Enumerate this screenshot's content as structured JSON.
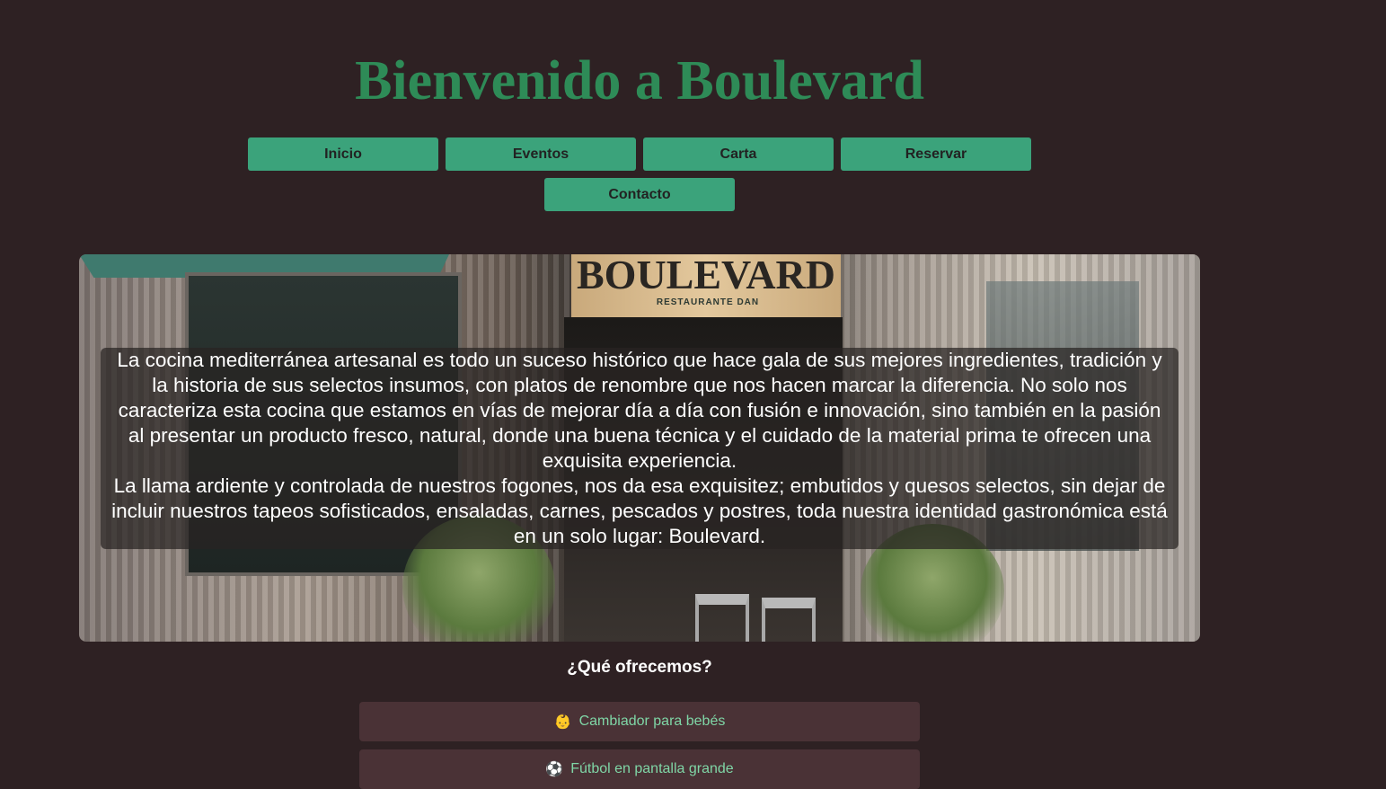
{
  "header": {
    "title": "Bienvenido a Boulevard"
  },
  "nav": {
    "items": [
      {
        "label": "Inicio"
      },
      {
        "label": "Eventos"
      },
      {
        "label": "Carta"
      },
      {
        "label": "Reservar"
      },
      {
        "label": "Contacto"
      }
    ]
  },
  "hero": {
    "sign_text": "BOULEVARD",
    "sign_subtext": "RESTAURANTE DAN",
    "paragraph_1": "La cocina mediterránea artesanal es todo un suceso histórico que hace gala de sus mejores ingredientes, tradición y la historia de sus selectos insumos, con platos de renombre que nos hacen marcar la diferencia. No solo nos caracteriza esta cocina que estamos en vías de mejorar día a día con fusión e innovación, sino también en la pasión al presentar un producto fresco, natural, donde una buena técnica y el cuidado de la material prima te ofrecen una exquisita experiencia.",
    "paragraph_2": "La llama ardiente y controlada de nuestros fogones, nos da esa exquisitez; embutidos y quesos selectos, sin dejar de incluir nuestros tapeos sofisticados, ensaladas, carnes, pescados y postres, toda nuestra identidad gastronómica está en un solo lugar: Boulevard."
  },
  "offers": {
    "heading": "¿Qué ofrecemos?",
    "items": [
      {
        "icon": "baby-icon",
        "glyph": "👶",
        "label": "Cambiador para bebés"
      },
      {
        "icon": "soccer-ball-icon",
        "glyph": "⚽",
        "label": "Fútbol en pantalla grande"
      }
    ]
  },
  "colors": {
    "background": "#2e2123",
    "title_green": "#2e8b57",
    "nav_button": "#3ba37b",
    "offer_item_bg": "#4a3236",
    "offer_text": "#7fd6a6"
  }
}
